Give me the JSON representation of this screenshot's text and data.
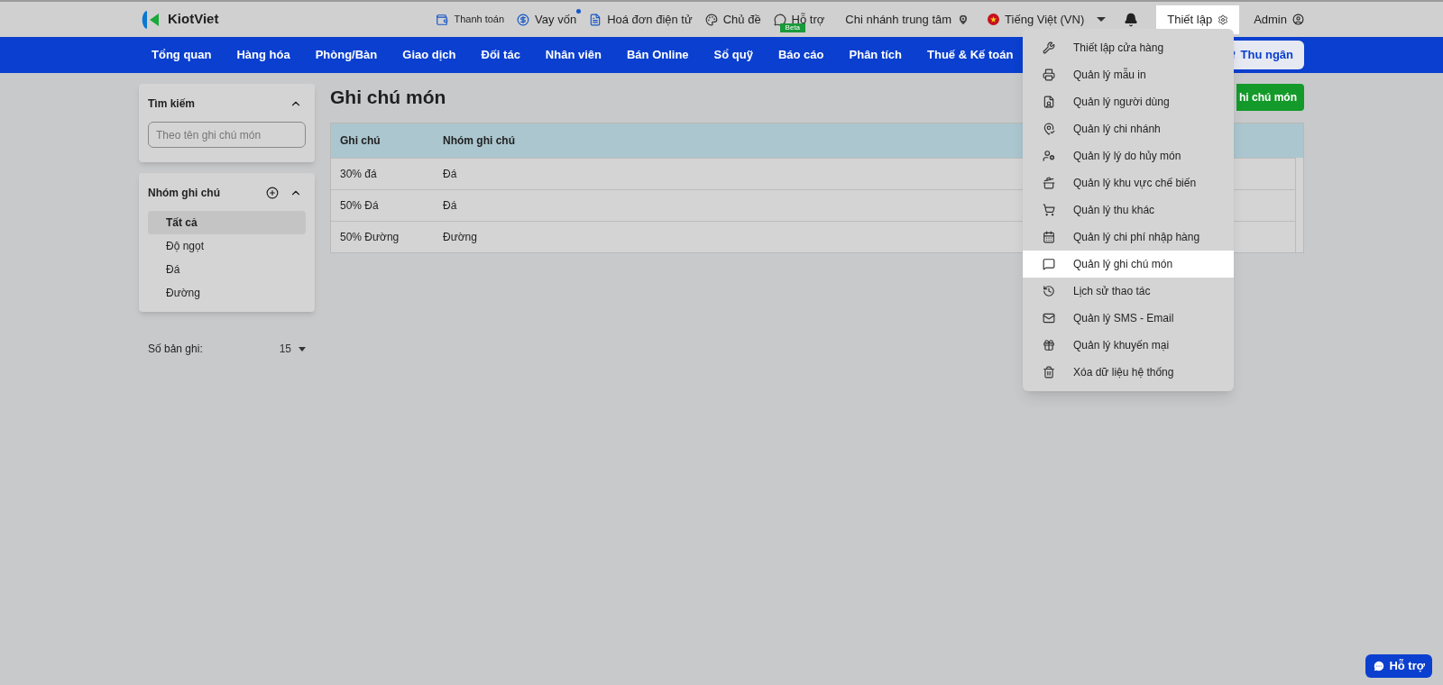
{
  "header": {
    "brand": "KiotViet",
    "links": [
      {
        "label": "Thanh toán"
      },
      {
        "label": "Vay vốn",
        "dot": true
      },
      {
        "label": "Hoá đơn điện tử"
      },
      {
        "label": "Chủ đề"
      },
      {
        "label": "Hỗ trợ",
        "badge": "Beta"
      }
    ],
    "branch": "Chi nhánh trung tâm",
    "language": "Tiếng Việt (VN)",
    "settings": "Thiết lập",
    "user": "Admin"
  },
  "nav": {
    "items": [
      {
        "label": "Tổng quan"
      },
      {
        "label": "Hàng hóa"
      },
      {
        "label": "Phòng/Bàn"
      },
      {
        "label": "Giao dịch"
      },
      {
        "label": "Đối tác"
      },
      {
        "label": "Nhân viên"
      },
      {
        "label": "Bán Online"
      },
      {
        "label": "Sổ quỹ"
      },
      {
        "label": "Báo cáo"
      },
      {
        "label": "Phân tích"
      },
      {
        "label": "Thuế & Kế toán"
      }
    ],
    "cashier": "Thu ngân"
  },
  "sidebar": {
    "search": {
      "title": "Tìm kiếm",
      "placeholder": "Theo tên ghi chú món"
    },
    "groups": {
      "title": "Nhóm ghi chú",
      "items": [
        {
          "label": "Tất cả",
          "selected": true
        },
        {
          "label": "Độ ngọt",
          "selected": false
        },
        {
          "label": "Đá",
          "selected": false
        },
        {
          "label": "Đường",
          "selected": false
        }
      ]
    },
    "page_size": {
      "label": "Số bản ghi:",
      "value": "15"
    }
  },
  "main": {
    "title": "Ghi chú món",
    "add_button": "hi chú món",
    "table": {
      "columns": [
        "Ghi chú",
        "Nhóm ghi chú"
      ],
      "rows": [
        [
          "30% đá",
          "Đá"
        ],
        [
          "50% Đá",
          "Đá"
        ],
        [
          "50% Đường",
          "Đường"
        ]
      ]
    }
  },
  "settings_menu": {
    "items": [
      {
        "label": "Thiết lập cửa hàng",
        "selected": false
      },
      {
        "label": "Quản lý mẫu in",
        "selected": false
      },
      {
        "label": "Quản lý người dùng",
        "selected": false
      },
      {
        "label": "Quản lý chi nhánh",
        "selected": false
      },
      {
        "label": "Quản lý lý do hủy món",
        "selected": false
      },
      {
        "label": "Quản lý khu vực chế biến",
        "selected": false
      },
      {
        "label": "Quản lý thu khác",
        "selected": false
      },
      {
        "label": "Quản lý chi phí nhập hàng",
        "selected": false
      },
      {
        "label": "Quản lý ghi chú món",
        "selected": true
      },
      {
        "label": "Lịch sử thao tác",
        "selected": false
      },
      {
        "label": "Quản lý SMS - Email",
        "selected": false
      },
      {
        "label": "Quản lý khuyến mại",
        "selected": false
      },
      {
        "label": "Xóa dữ liệu hệ thống",
        "selected": false
      }
    ]
  },
  "help_button": "Hỗ trợ"
}
